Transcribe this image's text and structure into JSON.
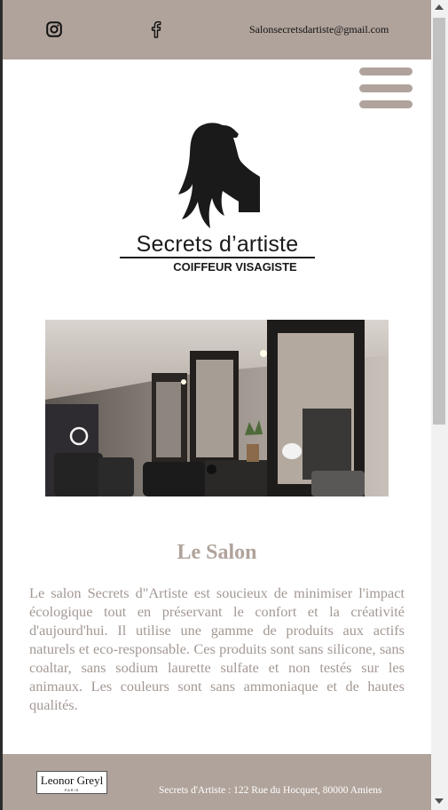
{
  "topbar": {
    "instagram_icon": "instagram-icon",
    "facebook_icon": "facebook-icon",
    "email": "Salonsecretsdartiste@gmail.com"
  },
  "menu": {
    "icon": "hamburger-menu-icon"
  },
  "logo": {
    "title": "Secrets d’artiste",
    "subtitle": "COIFFEUR VISAGISTE"
  },
  "carousel": {
    "image": "salon-interior-photo",
    "indicator": "carousel-dot"
  },
  "section": {
    "title": "Le Salon",
    "text": "Le salon Secrets d\"Artiste est soucieux de minimiser l'impact écologique tout en préservant le confort et la créativité d'aujourd'hui. Il utilise une gamme de produits aux actifs naturels et eco-responsable. Ces produits sont sans silicone, sans coaltar, sans sodium laurette sulfate et non testés sur les animaux. Les couleurs sont sans ammoniaque et de hautes qualités."
  },
  "footer": {
    "brand_name": "Leonor Greyl",
    "brand_sub": "PARIS",
    "address": "Secrets d'Artiste : 122 Rue du Hocquet, 80000 Amiens"
  },
  "colors": {
    "accent": "#b0a39b",
    "text": "#a39893"
  }
}
